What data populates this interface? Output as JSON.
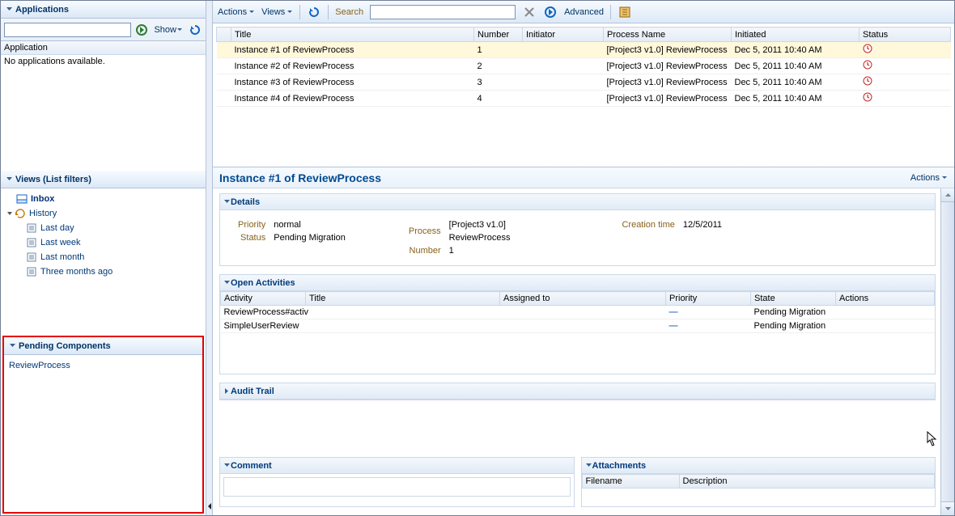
{
  "toolbar": {
    "actions": "Actions",
    "views": "Views",
    "search_label": "Search",
    "advanced": "Advanced",
    "search_value": ""
  },
  "grid": {
    "columns": [
      "Title",
      "Number",
      "Initiator",
      "Process Name",
      "Initiated",
      "Status"
    ],
    "rows": [
      {
        "title": "Instance #1 of ReviewProcess",
        "number": "1",
        "initiator": "",
        "process": "[Project3 v1.0] ReviewProcess",
        "initiated": "Dec 5, 2011 10:40 AM"
      },
      {
        "title": "Instance #2 of ReviewProcess",
        "number": "2",
        "initiator": "",
        "process": "[Project3 v1.0] ReviewProcess",
        "initiated": "Dec 5, 2011 10:40 AM"
      },
      {
        "title": "Instance #3 of ReviewProcess",
        "number": "3",
        "initiator": "",
        "process": "[Project3 v1.0] ReviewProcess",
        "initiated": "Dec 5, 2011 10:40 AM"
      },
      {
        "title": "Instance #4 of ReviewProcess",
        "number": "4",
        "initiator": "",
        "process": "[Project3 v1.0] ReviewProcess",
        "initiated": "Dec 5, 2011 10:40 AM"
      }
    ]
  },
  "left": {
    "applications_hdr": "Applications",
    "show": "Show",
    "app_col": "Application",
    "app_empty": "No applications available.",
    "views_hdr": "Views (List filters)",
    "views": {
      "inbox": "Inbox",
      "history": "History",
      "lastday": "Last day",
      "lastweek": "Last week",
      "lastmonth": "Last month",
      "three": "Three months ago"
    },
    "pending_hdr": "Pending Components",
    "pending_item": "ReviewProcess"
  },
  "instance": {
    "title": "Instance #1 of ReviewProcess",
    "actions": "Actions",
    "details_hdr": "Details",
    "priority_l": "Priority",
    "priority_v": "normal",
    "status_l": "Status",
    "status_v": "Pending Migration",
    "process_l": "Process",
    "process_v1": "[Project3 v1.0]",
    "process_v2": "ReviewProcess",
    "number_l": "Number",
    "number_v": "1",
    "creation_l": "Creation time",
    "creation_v": "12/5/2011",
    "open_hdr": "Open Activities",
    "oa_cols": [
      "Activity",
      "Title",
      "Assigned to",
      "Priority",
      "State",
      "Actions"
    ],
    "oa_rows": [
      {
        "activity": "ReviewProcess#activ",
        "title": "",
        "assigned": "",
        "priority": "—",
        "state": "Pending Migration"
      },
      {
        "activity": "SimpleUserReview",
        "title": "",
        "assigned": "",
        "priority": "—",
        "state": "Pending Migration"
      }
    ],
    "audit_hdr": "Audit Trail",
    "comment_hdr": "Comment",
    "attach_hdr": "Attachments",
    "attach_cols": [
      "Filename",
      "Description"
    ]
  }
}
